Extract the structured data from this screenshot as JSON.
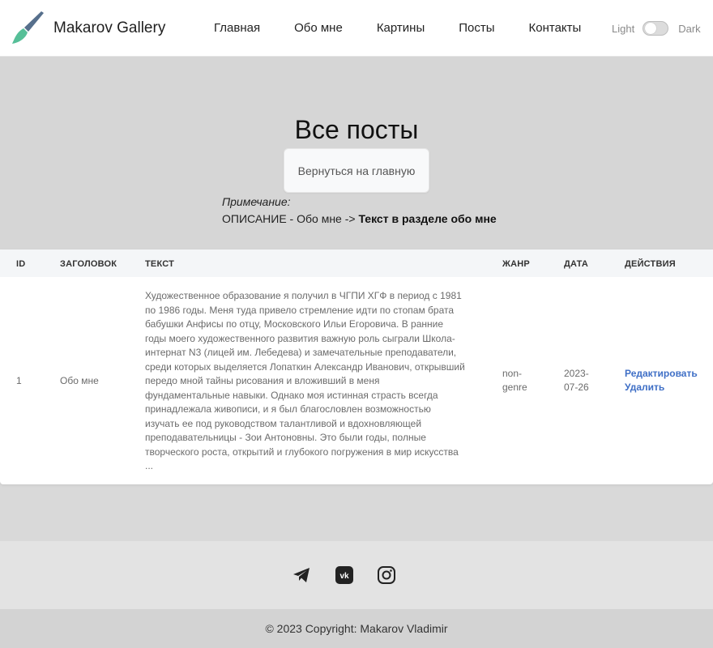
{
  "header": {
    "brand": "Makarov Gallery",
    "nav": [
      "Главная",
      "Обо мне",
      "Картины",
      "Посты",
      "Контакты"
    ],
    "theme_light": "Light",
    "theme_dark": "Dark"
  },
  "hero": {
    "title": "Все посты",
    "back_button": "Вернуться на главную",
    "note_label": "Примечание:",
    "note_prefix": "ОПИСАНИЕ - Обо мне ->",
    "note_target": "Текст в разделе обо мне"
  },
  "table": {
    "headers": [
      "ID",
      "ЗАГОЛОВОК",
      "ТЕКСТ",
      "ЖАНР",
      "ДАТА",
      "ДЕЙСТВИЯ"
    ],
    "rows": [
      {
        "id": "1",
        "title": "Обо мне",
        "text_lines": [
          "Художественное образование я получил в ЧГПИ ХГФ в период с 1981",
          "по 1986 годы. Меня туда привело стремление идти по стопам брата",
          "бабушки Анфисы по отцу, Московского Ильи Егоровича. В ранние",
          "годы моего художественного развития важную роль сыграли Школа-",
          "интернат N3 (лицей им. Лебедева) и замечательные преподаватели,",
          "среди которых выделяется Лопаткин Александр Иванович, открывший",
          "передо мной тайны рисования и вложивший в меня",
          "фундаментальные навыки. Однако моя истинная страсть всегда",
          "принадлежала живописи, и я был благословлен возможностью",
          "изучать ее под руководством талантливой и вдохновляющей",
          "преподавательницы - Зои Антоновны. Это были годы, полные",
          "творческого роста, открытий и глубокого погружения в мир искусства",
          "..."
        ],
        "genre_line1": "non-",
        "genre_line2": "genre",
        "date_line1": "2023-",
        "date_line2": "07-26",
        "action_edit": "Редактировать",
        "action_delete": "Удалить"
      }
    ]
  },
  "footer": {
    "social": [
      "telegram-icon",
      "vk-icon",
      "instagram-icon"
    ],
    "copyright": "© 2023 Copyright: Makarov Vladimir"
  },
  "colors": {
    "brush_handle": "#4f6f8f",
    "brush_tip": "#4fbf9a",
    "link": "#3f6fc6"
  }
}
